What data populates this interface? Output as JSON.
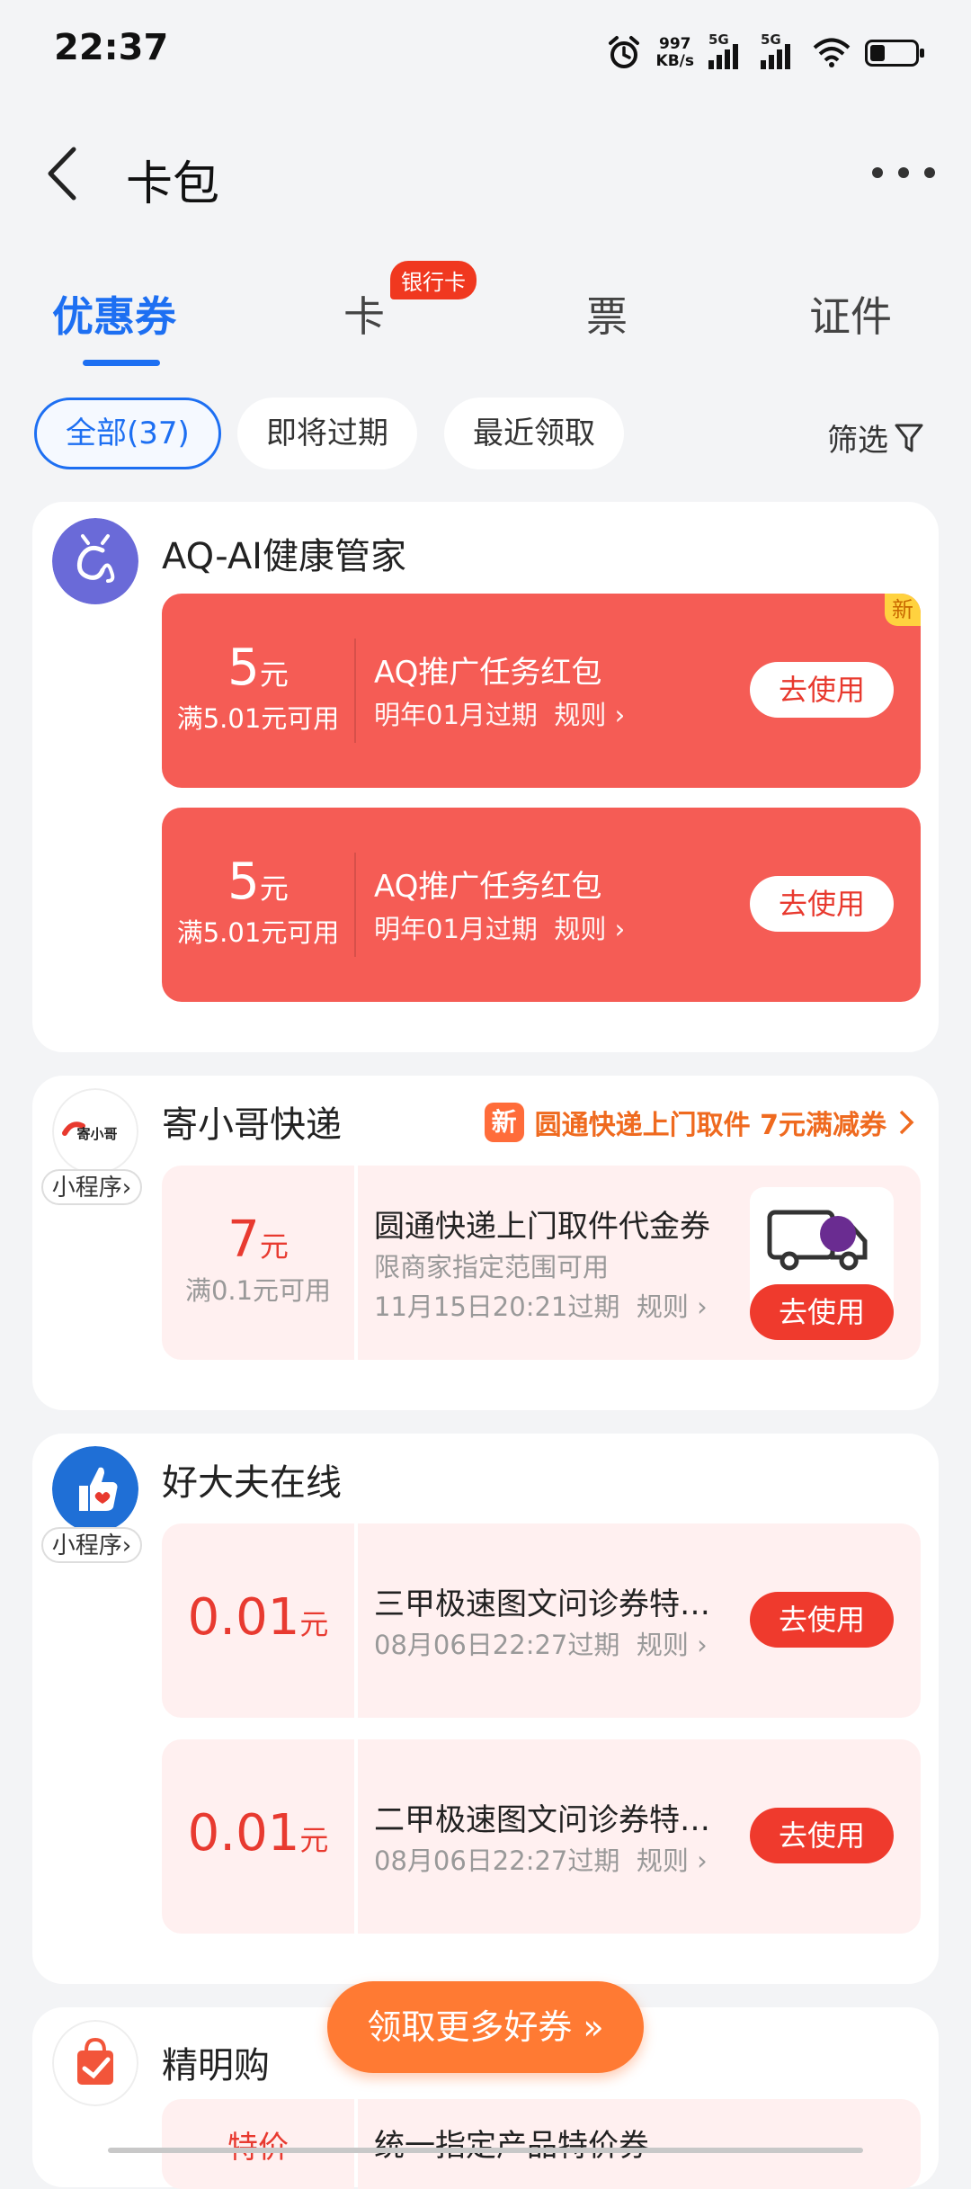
{
  "status_bar": {
    "time": "22:37",
    "net_speed_value": "997",
    "net_speed_unit": "KB/s",
    "signal1_label": "5G",
    "signal2_label": "5G",
    "icons": [
      "alarm-icon",
      "signal-icon",
      "wifi-icon",
      "battery-icon"
    ]
  },
  "header": {
    "title": "卡包",
    "back_icon": "chevron-left-icon",
    "more_icon": "more-icon"
  },
  "tabs": [
    {
      "label": "优惠券",
      "active": true
    },
    {
      "label": "卡",
      "badge": "银行卡"
    },
    {
      "label": "票"
    },
    {
      "label": "证件"
    }
  ],
  "filters": {
    "chips": [
      "全部(37)",
      "即将过期",
      "最近领取"
    ],
    "filter_label": "筛选"
  },
  "cards": [
    {
      "merchant": "AQ-AI健康管家",
      "coupons": [
        {
          "amount": "5",
          "unit": "元",
          "condition": "满5.01元可用",
          "title": "AQ推广任务红包",
          "expiry": "明年01月过期",
          "rules": "规则",
          "button": "去使用",
          "new_badge": "新"
        },
        {
          "amount": "5",
          "unit": "元",
          "condition": "满5.01元可用",
          "title": "AQ推广任务红包",
          "expiry": "明年01月过期",
          "rules": "规则",
          "button": "去使用"
        }
      ]
    },
    {
      "merchant": "寄小哥快递",
      "logo_text": "寄小哥",
      "mini_tag": "小程序",
      "promo_icon": "新",
      "promo": "圆通快递上门取件 7元满减券",
      "coupons": [
        {
          "amount": "7",
          "unit": "元",
          "condition": "满0.1元可用",
          "title": "圆通快递上门取件代金券",
          "sub": "限商家指定范围可用",
          "expiry": "11月15日20:21过期",
          "rules": "规则",
          "button": "去使用"
        }
      ]
    },
    {
      "merchant": "好大夫在线",
      "mini_tag": "小程序",
      "coupons": [
        {
          "amount": "0.01",
          "unit": "元",
          "title": "三甲极速图文问诊券特…",
          "expiry": "08月06日22:27过期",
          "rules": "规则",
          "button": "去使用"
        },
        {
          "amount": "0.01",
          "unit": "元",
          "title": "二甲极速图文问诊券特…",
          "expiry": "08月06日22:27过期",
          "rules": "规则",
          "button": "去使用"
        }
      ]
    },
    {
      "merchant": "精明购",
      "coupons": [
        {
          "amount": "特价",
          "title": "统一指定产品特价券"
        }
      ]
    }
  ],
  "float_button": "领取更多好券 »",
  "colors": {
    "accent": "#1d6ff2",
    "coupon_red": "#f55c55",
    "button_red": "#ef3a2d",
    "orange": "#ff7a33"
  }
}
